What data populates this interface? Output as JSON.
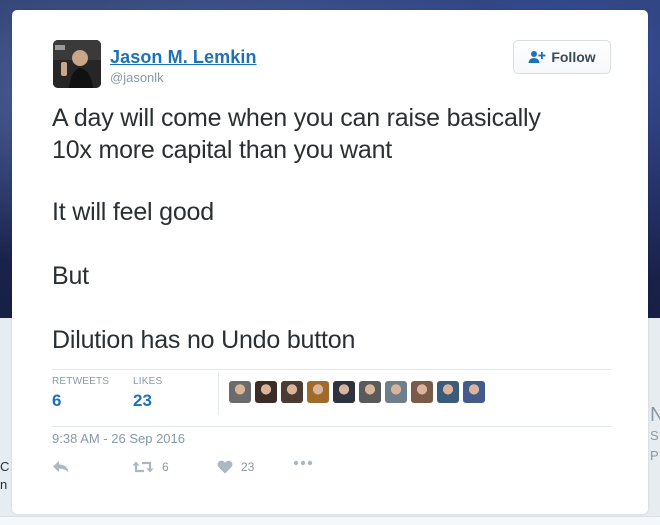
{
  "tweet": {
    "author_name": "Jason M. Lemkin",
    "author_handle": "@jasonlk",
    "follow_label": "Follow",
    "text": [
      "A day will come when you can raise basically 10x more capital than you want",
      "It will feel good",
      "But",
      "Dilution has no Undo button"
    ],
    "stats": {
      "retweets_label": "RETWEETS",
      "retweets_count": "6",
      "likes_label": "LIKES",
      "likes_count": "23"
    },
    "timestamp": "9:38 AM - 26 Sep 2016",
    "actions": {
      "reply_icon": "reply-icon",
      "retweet_icon": "retweet-icon",
      "retweet_count": "6",
      "like_icon": "heart-icon",
      "like_count": "23",
      "more_icon": "more-icon"
    },
    "liker_avatar_colors": [
      "#6b6b6b",
      "#3a2d28",
      "#4b3b33",
      "#a06a2b",
      "#2f3340",
      "#5a5a5a",
      "#6c7f8a",
      "#7a5a48",
      "#3b5b7a",
      "#445a8c"
    ]
  },
  "background": {
    "left_snippet": [
      "C",
      "n"
    ],
    "right_snippet": [
      "N",
      "S",
      "P"
    ]
  },
  "colors": {
    "link_blue": "#1d71b8",
    "muted_gray": "#8899a6",
    "text_dark": "#292f33"
  }
}
